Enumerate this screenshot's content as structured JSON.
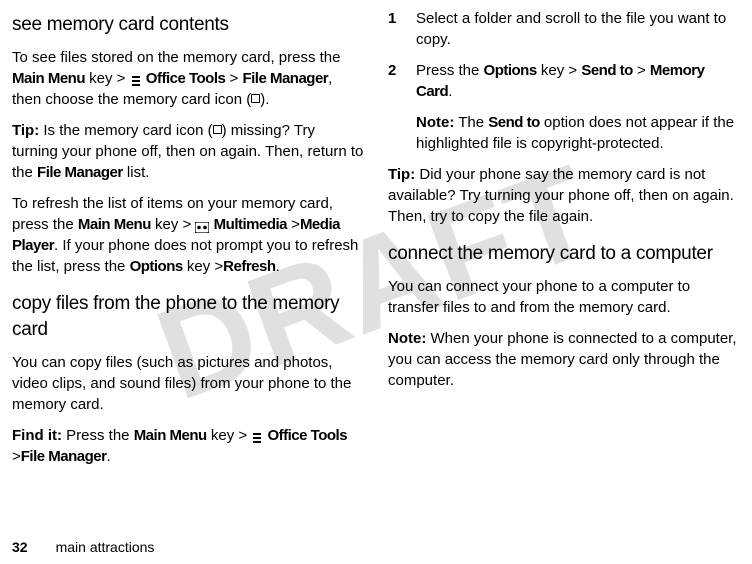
{
  "watermark": "DRAFT",
  "left": {
    "h1": "see memory card contents",
    "p1a": "To see files stored on the memory card, press the ",
    "mainMenu": "Main Menu",
    "keyGt": " key >",
    "officeTools": "Office Tools",
    "gt": " > ",
    "fileManager": "File Manager",
    "p1b": ", then choose the memory card icon (",
    "p1c": ").",
    "tipLabel": "Tip:",
    "tip1a": " Is the memory card icon (",
    "tip1b": ") missing? Try turning your phone off, then on again. Then, return to the ",
    "tip1c": " list.",
    "p2a": "To refresh the list of items on your memory card, press the ",
    "multimedia": "Multimedia",
    "mediaPlayer": "Media Player",
    "p2b": ". If your phone does not prompt you to refresh the list, press the ",
    "options": "Options",
    "refresh": "Refresh",
    "p2c": ".",
    "h2": "copy files from the phone to the memory card",
    "p3": "You can copy files (such as pictures and photos, video clips, and sound files) from your phone to the memory card.",
    "findIt": "Find it:",
    "p4a": " Press the "
  },
  "right": {
    "step1": "Select a folder and scroll to the file you want to copy.",
    "step2a": "Press the ",
    "options": "Options",
    "keyGt": " key > ",
    "sendTo": "Send to",
    "gt": " > ",
    "memoryCard": "Memory Card",
    "step2b": ".",
    "noteLabel": "Note:",
    "note1a": " The ",
    "note1b": " option does not appear if the highlighted file is copyright-protected.",
    "tipLabel": "Tip:",
    "tip1": " Did your phone say the memory card is not available? Try turning your phone off, then on again. Then, try to copy the file again.",
    "h1": "connect the memory card to a computer",
    "p1": "You can connect your phone to a computer to transfer files to and from the memory card.",
    "note2": " When your phone is connected to a computer, you can access the memory card only through the computer."
  },
  "footer": {
    "page": "32",
    "section": "main attractions"
  }
}
